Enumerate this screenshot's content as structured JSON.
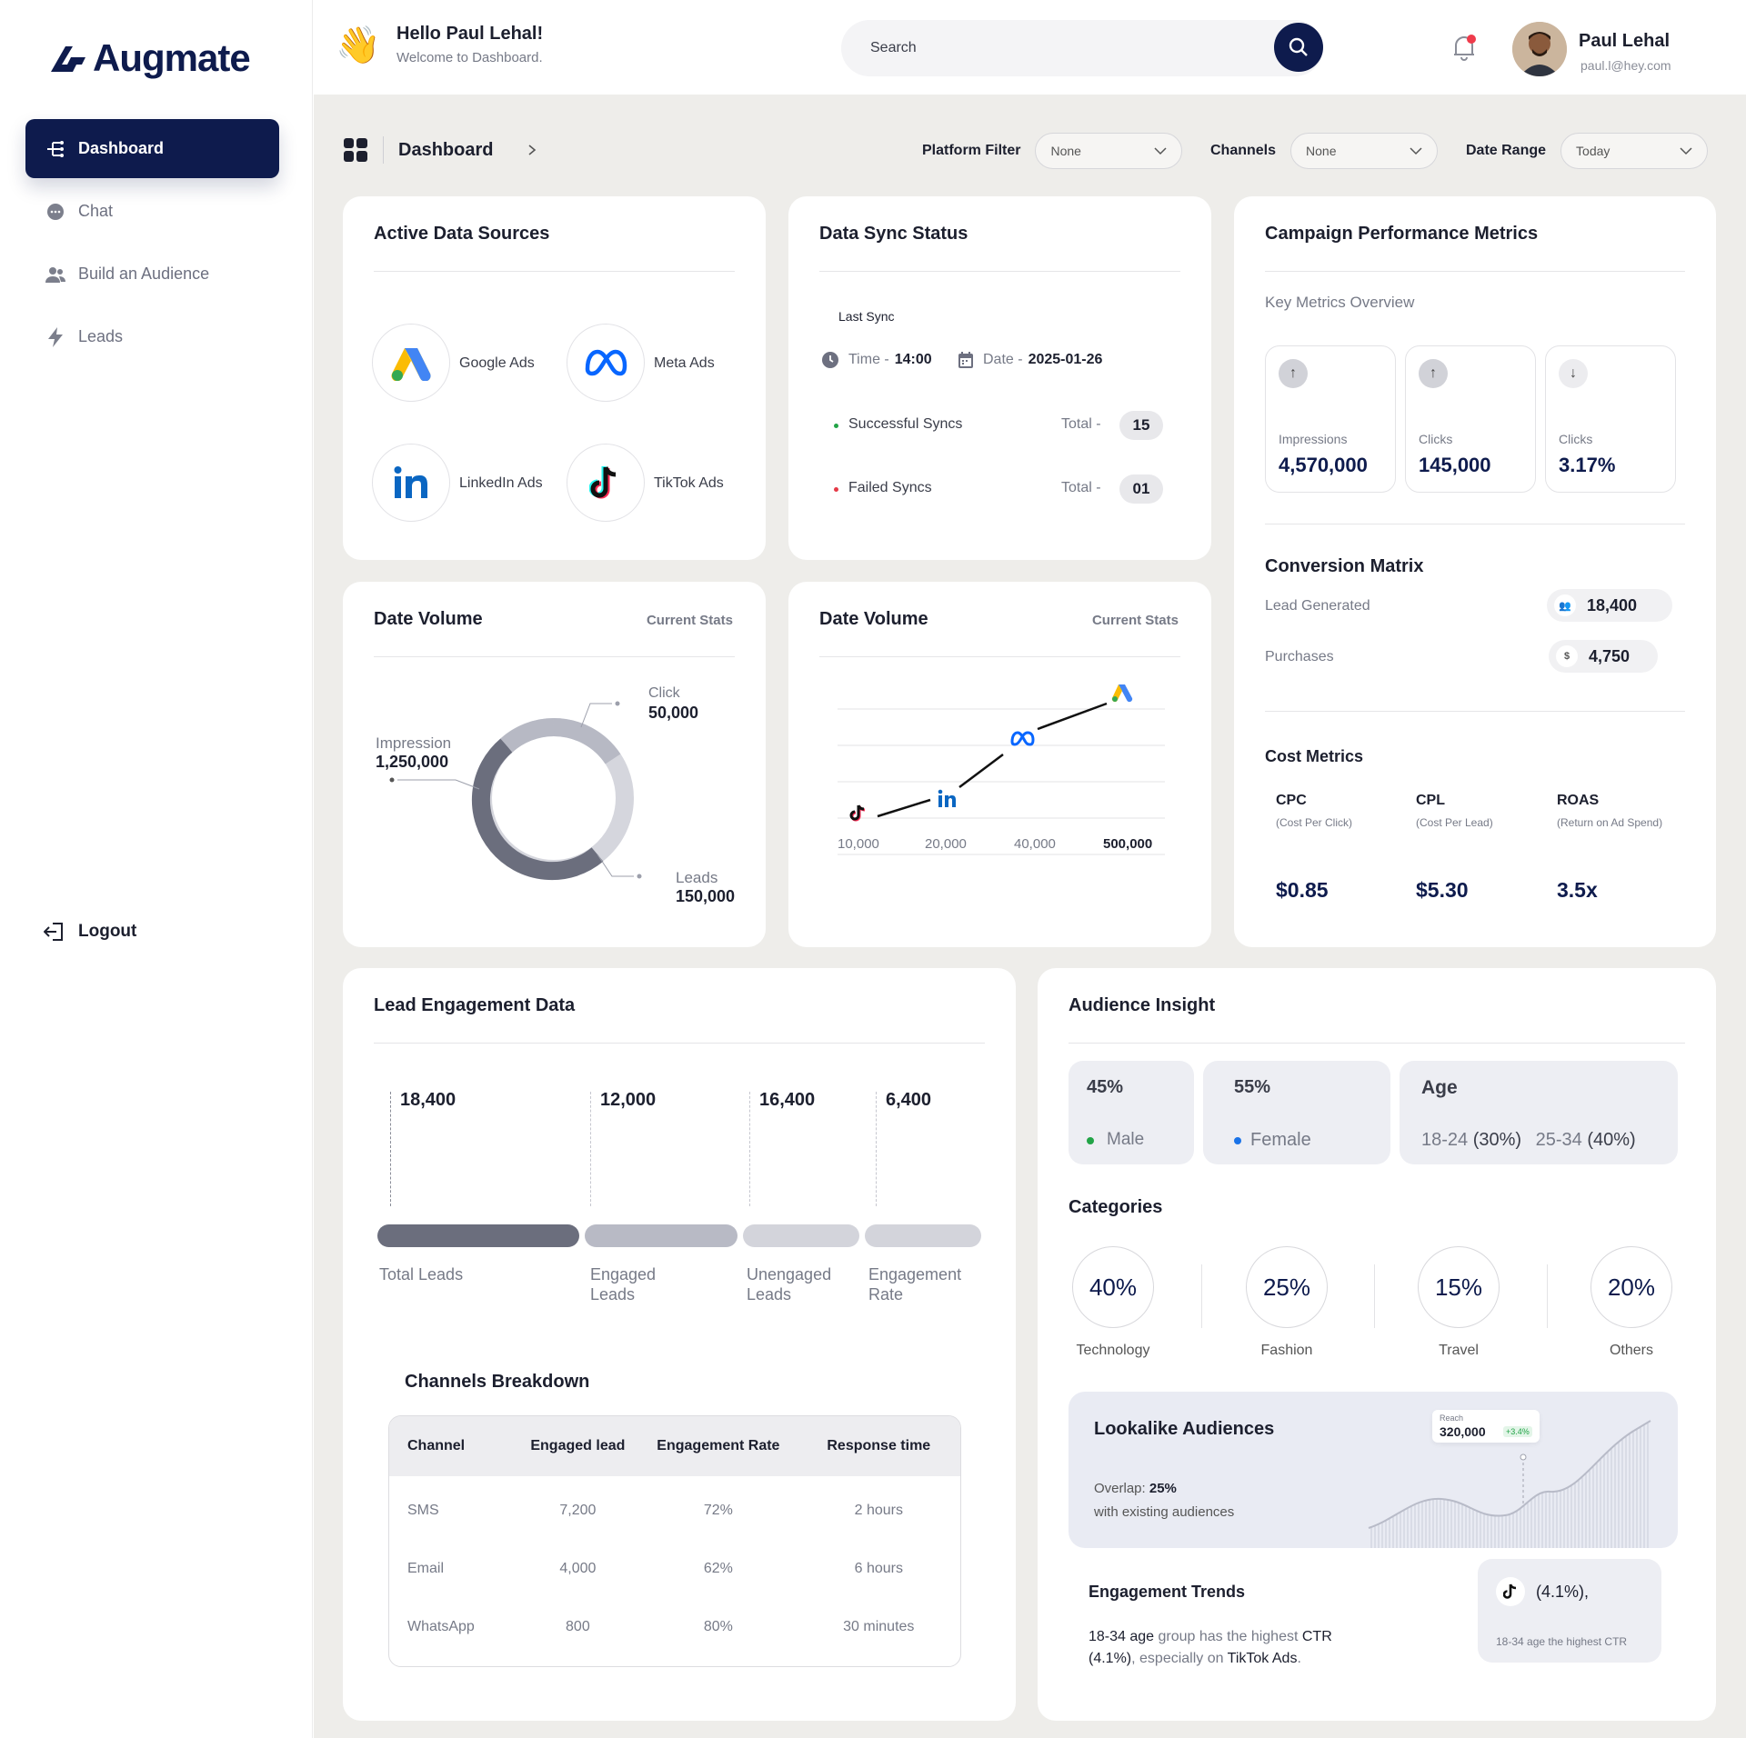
{
  "app": {
    "name": "Augmate"
  },
  "sidebar": {
    "items": [
      {
        "label": "Dashboard",
        "icon": "hierarchy-icon",
        "active": true
      },
      {
        "label": "Chat",
        "icon": "chat-icon",
        "active": false
      },
      {
        "label": "Build an Audience",
        "icon": "users-icon",
        "active": false
      },
      {
        "label": "Leads",
        "icon": "bolt-icon",
        "active": false
      }
    ],
    "logout_label": "Logout"
  },
  "header": {
    "greeting": "Hello Paul Lehal!",
    "subtitle": "Welcome to Dashboard.",
    "search_placeholder": "Search",
    "user_name": "Paul Lehal",
    "user_email": "paul.l@hey.com"
  },
  "toolbar": {
    "breadcrumb": "Dashboard",
    "platform_filter": {
      "label": "Platform Filter",
      "value": "None"
    },
    "channels": {
      "label": "Channels",
      "value": "None"
    },
    "date_range": {
      "label": "Date Range",
      "value": "Today"
    }
  },
  "active_sources": {
    "title": "Active Data Sources",
    "sources": [
      "Google Ads",
      "Meta Ads",
      "LinkedIn Ads",
      "TikTok Ads"
    ]
  },
  "sync": {
    "title": "Data Sync Status",
    "last_sync_label": "Last Sync",
    "time_label": "Time -",
    "time_value": "14:00",
    "date_label": "Date -",
    "date_value": "2025-01-26",
    "success_label": "Successful Syncs",
    "failed_label": "Failed Syncs",
    "total_label": "Total -",
    "success_total": "15",
    "failed_total": "01",
    "colors": {
      "success": "#22a447",
      "failed": "#e53946"
    }
  },
  "volume_donut": {
    "title": "Date Volume",
    "subtitle": "Current Stats",
    "segments": [
      {
        "label": "Impression",
        "value": "1,250,000"
      },
      {
        "label": "Click",
        "value": "50,000"
      },
      {
        "label": "Leads",
        "value": "150,000"
      }
    ]
  },
  "volume_line": {
    "title": "Date Volume",
    "subtitle": "Current Stats",
    "ticks": [
      "10,000",
      "20,000",
      "40,000",
      "500,000"
    ]
  },
  "campaign": {
    "title": "Campaign Performance Metrics",
    "overview_label": "Key Metrics Overview",
    "metrics": [
      {
        "label": "Impressions",
        "value": "4,570,000",
        "direction": "up"
      },
      {
        "label": "Clicks",
        "value": "145,000",
        "direction": "up"
      },
      {
        "label": "Clicks",
        "value": "3.17%",
        "direction": "down"
      }
    ],
    "conversion_title": "Conversion Matrix",
    "conversion": [
      {
        "label": "Lead Generated",
        "value": "18,400"
      },
      {
        "label": "Purchases",
        "value": "4,750"
      }
    ],
    "cost_title": "Cost Metrics",
    "costs": [
      {
        "label": "CPC",
        "desc": "(Cost Per Click)",
        "value": "$0.85"
      },
      {
        "label": "CPL",
        "desc": "(Cost Per Lead)",
        "value": "$5.30"
      },
      {
        "label": "ROAS",
        "desc": "(Return on Ad Spend)",
        "value": "3.5x"
      }
    ]
  },
  "lead_engagement": {
    "title": "Lead Engagement Data",
    "bars": [
      {
        "label": "Total Leads",
        "value": "18,400"
      },
      {
        "label": "Engaged Leads",
        "value": "12,000"
      },
      {
        "label": "Unengaged Leads",
        "value": "16,400"
      },
      {
        "label": "Engagement Rate",
        "value": "6,400"
      }
    ],
    "breakdown_title": "Channels Breakdown",
    "table_headers": [
      "Channel",
      "Engaged lead",
      "Engagement Rate",
      "Response time"
    ],
    "table_rows": [
      [
        "SMS",
        "7,200",
        "72%",
        "2 hours"
      ],
      [
        "Email",
        "4,000",
        "62%",
        "6 hours"
      ],
      [
        "WhatsApp",
        "800",
        "80%",
        "30 minutes"
      ]
    ]
  },
  "audience": {
    "title": "Audience Insight",
    "male_pct": "45%",
    "male_label": "Male",
    "female_pct": "55%",
    "female_label": "Female",
    "age_label": "Age",
    "age_a_range": "18-24",
    "age_a_pct": "(30%)",
    "age_b_range": "25-34",
    "age_b_pct": "(40%)",
    "categories_title": "Categories",
    "categories": [
      {
        "pct": "40%",
        "label": "Technology"
      },
      {
        "pct": "25%",
        "label": "Fashion"
      },
      {
        "pct": "15%",
        "label": "Travel"
      },
      {
        "pct": "20%",
        "label": "Others"
      }
    ],
    "lookalike": {
      "title": "Lookalike Audiences",
      "overlap_label": "Overlap:",
      "overlap_value": "25%",
      "overlap_desc": "with existing audiences",
      "reach_label": "Reach",
      "reach_value": "320,000",
      "reach_change": "+3.4%"
    },
    "trends": {
      "title": "Engagement Trends",
      "age_group": "18-34 age",
      "text1": "group has the highest",
      "ctr_label": "CTR",
      "ctr_value": "(4.1%)",
      "text2": ", especially on",
      "platform": "TikTok Ads",
      "badge_value": "(4.1%),",
      "badge_desc": "18-34 age the highest CTR"
    }
  }
}
